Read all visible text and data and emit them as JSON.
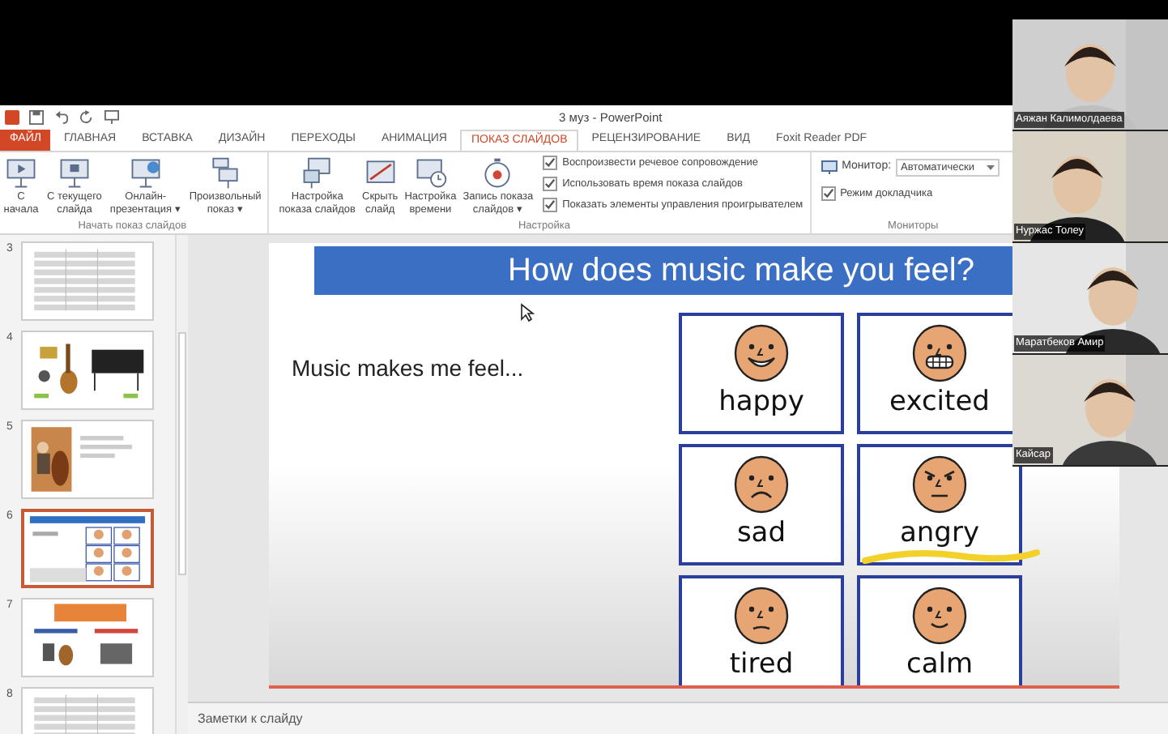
{
  "window": {
    "title": "3 муз - PowerPoint"
  },
  "tabs": [
    {
      "label": "ФАЙЛ",
      "kind": "file",
      "selected": false
    },
    {
      "label": "ГЛАВНАЯ",
      "kind": "tab",
      "selected": false
    },
    {
      "label": "ВСТАВКА",
      "kind": "tab",
      "selected": false
    },
    {
      "label": "ДИЗАЙН",
      "kind": "tab",
      "selected": false
    },
    {
      "label": "ПЕРЕХОДЫ",
      "kind": "tab",
      "selected": false
    },
    {
      "label": "АНИМАЦИЯ",
      "kind": "tab",
      "selected": false
    },
    {
      "label": "ПОКАЗ СЛАЙДОВ",
      "kind": "tab",
      "selected": true
    },
    {
      "label": "РЕЦЕНЗИРОВАНИЕ",
      "kind": "tab",
      "selected": false
    },
    {
      "label": "ВИД",
      "kind": "tab",
      "selected": false
    },
    {
      "label": "Foxit Reader PDF",
      "kind": "tab",
      "selected": false
    }
  ],
  "ribbon": {
    "groups": [
      {
        "label": "Начать показ слайдов",
        "buttons": [
          {
            "label": "С\nначала"
          },
          {
            "label": "С текущего\nслайда"
          },
          {
            "label": "Онлайн-\nпрезентация ▾"
          },
          {
            "label": "Произвольный\nпоказ ▾"
          }
        ]
      },
      {
        "label": "Настройка",
        "buttons": [
          {
            "label": "Настройка\nпоказа слайдов"
          },
          {
            "label": "Скрыть\nслайд"
          },
          {
            "label": "Настройка\nвремени"
          },
          {
            "label": "Запись показа\nслайдов ▾"
          }
        ],
        "checkboxes": [
          {
            "label": "Воспроизвести речевое сопровождение",
            "checked": true
          },
          {
            "label": "Использовать время показа слайдов",
            "checked": true
          },
          {
            "label": "Показать элементы управления проигрывателем",
            "checked": true
          }
        ]
      },
      {
        "label": "Мониторы",
        "monitor_label": "Монитор:",
        "monitor_value": "Автоматически",
        "checkboxes": [
          {
            "label": "Режим докладчика",
            "checked": true
          }
        ]
      }
    ]
  },
  "thumbnails": [
    {
      "number": "3",
      "selected": false
    },
    {
      "number": "4",
      "selected": false
    },
    {
      "number": "5",
      "selected": false
    },
    {
      "number": "6",
      "selected": true
    },
    {
      "number": "7",
      "selected": false
    },
    {
      "number": "8",
      "selected": false
    }
  ],
  "slide": {
    "title": "How does music make you feel?",
    "text": "Music makes me feel...",
    "cards": [
      {
        "label": "happy"
      },
      {
        "label": "excited"
      },
      {
        "label": "sad"
      },
      {
        "label": "angry"
      },
      {
        "label": "tired"
      },
      {
        "label": "calm"
      }
    ]
  },
  "notes": {
    "label": "Заметки к слайду"
  },
  "participants": [
    {
      "name": "Аяжан Калимолдаева"
    },
    {
      "name": "Нуржас Толеу"
    },
    {
      "name": "Маратбеков Амир"
    },
    {
      "name": "Кайсар"
    }
  ]
}
